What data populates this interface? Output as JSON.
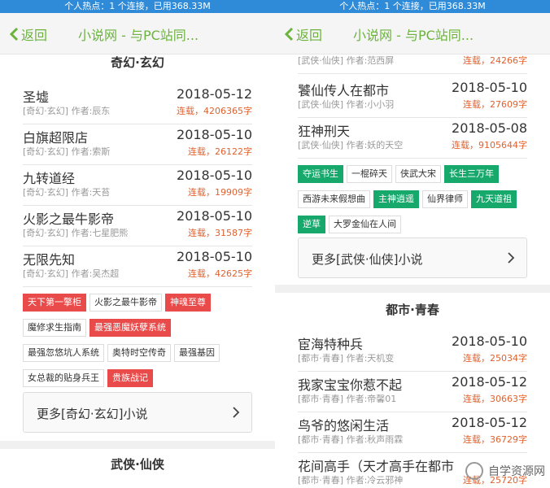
{
  "status_text": "个人热点：1 个连接，已用368.33M",
  "nav": {
    "back_label": "返回",
    "title": "小说网 - 与PC站同..."
  },
  "left": {
    "section_title": "奇幻·玄幻",
    "books": [
      {
        "name": "圣墟",
        "date": "2018-05-12",
        "meta": "[奇幻·玄幻] 作者:辰东",
        "status": "连载，4206365字"
      },
      {
        "name": "白旗超限店",
        "date": "2018-05-10",
        "meta": "[奇幻·玄幻] 作者:索斯",
        "status": "连载，26122字"
      },
      {
        "name": "九转道经",
        "date": "2018-05-10",
        "meta": "[奇幻·玄幻] 作者:天苔",
        "status": "连载，19909字"
      },
      {
        "name": "火影之最牛影帝",
        "date": "2018-05-10",
        "meta": "[奇幻·玄幻] 作者:七星肥熊",
        "status": "连载，31587字"
      },
      {
        "name": "无限先知",
        "date": "2018-05-10",
        "meta": "[奇幻·玄幻] 作者:吴杰超",
        "status": "连载，42625字"
      }
    ],
    "tag_rows": [
      [
        {
          "t": "天下第一擎柜",
          "c": "red"
        },
        {
          "t": "火影之最牛影帝",
          "c": ""
        },
        {
          "t": "神魂至尊",
          "c": "red"
        }
      ],
      [
        {
          "t": "魔修求生指南",
          "c": ""
        },
        {
          "t": "最强恶魔妖孽系统",
          "c": "red"
        }
      ],
      [
        {
          "t": "最强忽悠坑人系统",
          "c": ""
        },
        {
          "t": "奥特时空传奇",
          "c": ""
        },
        {
          "t": "最强基因",
          "c": ""
        }
      ],
      [
        {
          "t": "女总裁的贴身兵王",
          "c": ""
        },
        {
          "t": "贵族战记",
          "c": "red"
        }
      ]
    ],
    "more_label": "更多[奇幻·玄幻]小说",
    "next_section_title": "武侠·仙侠"
  },
  "right": {
    "top_book": {
      "meta": "[武侠·仙侠] 作者:范西屏",
      "status": "连载，24266字"
    },
    "books": [
      {
        "name": "饕仙传人在都市",
        "date": "2018-05-10",
        "meta": "[武侠·仙侠] 作者:小小羽",
        "status": "连载，27609字"
      },
      {
        "name": "狂神刑天",
        "date": "2018-05-08",
        "meta": "[武侠·仙侠] 作者:妖的天空",
        "status": "连载，9105644字"
      }
    ],
    "tag_rows": [
      [
        {
          "t": "夺运书生",
          "c": "green"
        },
        {
          "t": "一棍碎天",
          "c": ""
        },
        {
          "t": "侠武大宋",
          "c": ""
        },
        {
          "t": "长生三万年",
          "c": "green"
        }
      ],
      [
        {
          "t": "西游未来假想曲",
          "c": ""
        },
        {
          "t": "主神逍遥",
          "c": "green"
        },
        {
          "t": "仙界律师",
          "c": ""
        },
        {
          "t": "九天道祖",
          "c": "green"
        }
      ],
      [
        {
          "t": "逆草",
          "c": "green"
        },
        {
          "t": "大罗金仙在人间",
          "c": ""
        }
      ]
    ],
    "more_label": "更多[武侠·仙侠]小说",
    "section_title": "都市·青春",
    "books2": [
      {
        "name": "宦海特种兵",
        "date": "2018-05-10",
        "meta": "[都市·青春] 作者:天机变",
        "status": "连载，25034字"
      },
      {
        "name": "我家宝宝你惹不起",
        "date": "2018-05-12",
        "meta": "[都市·青春] 作者:帝馨01",
        "status": "连载，30663字"
      },
      {
        "name": "鸟爷的悠闲生活",
        "date": "2018-05-12",
        "meta": "[都市·青春] 作者:秋声雨霖",
        "status": "连载，36729字"
      },
      {
        "name": "花间高手（天才高手在都市",
        "date": "",
        "meta": "[都市·青春] 作者:冷云邪神",
        "status": "连载，25720字"
      }
    ],
    "watermark": "自学资源网"
  },
  "colors": {
    "accent_green": "#6cb33e",
    "status_orange": "#e0622f",
    "tag_red": "#e94b4b",
    "tag_green": "#17a86c",
    "statusbar_blue": "#2f8bd8"
  },
  "icons": {
    "back": "chevron-left-icon",
    "more": "chevron-right-icon"
  }
}
